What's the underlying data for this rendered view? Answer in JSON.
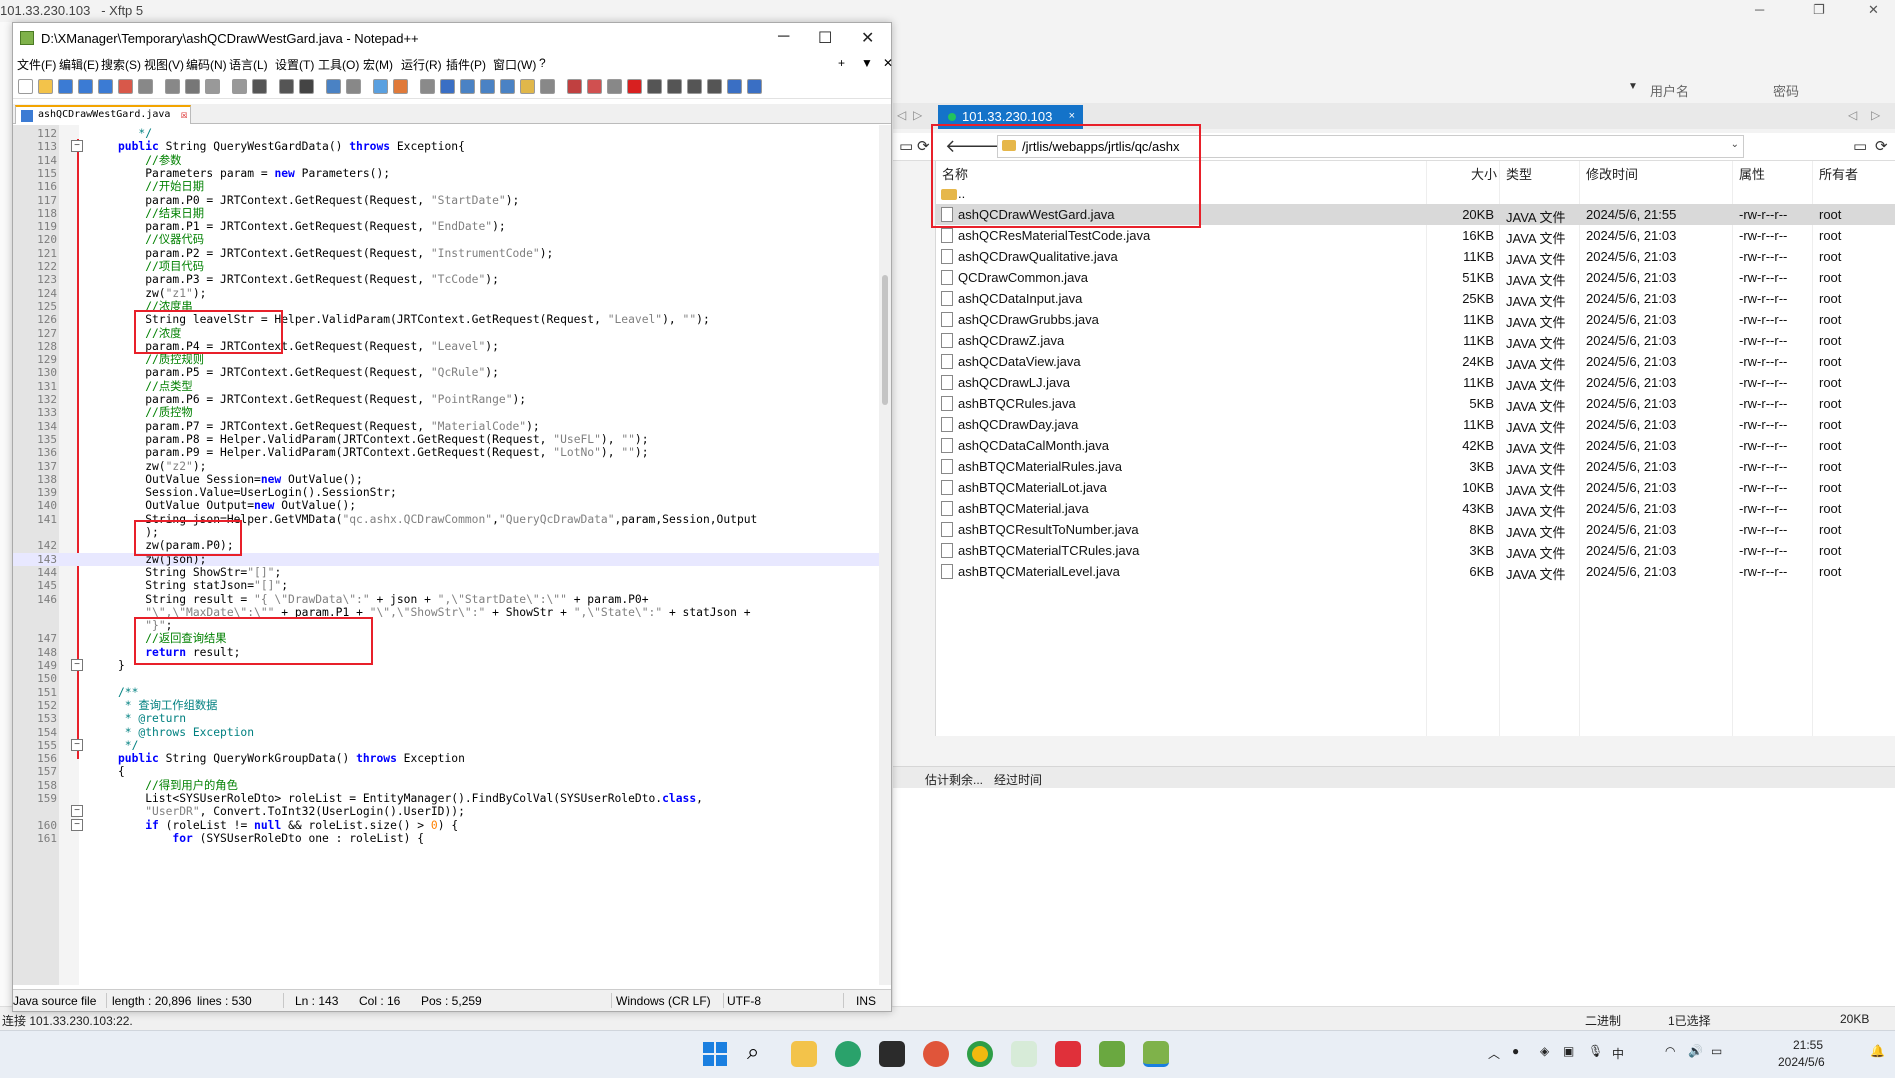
{
  "xftp": {
    "title": "101.33.230.103",
    "app": "- Xftp 5",
    "toolbar": {
      "username_label": "用户名",
      "password_label": "密码"
    },
    "tab_label": "101.33.230.103",
    "tab_close": "×",
    "address_path": "/jrtlis/webapps/jrtlis/qc/ashx",
    "columns": [
      "名称",
      "大小",
      "类型",
      "修改时间",
      "属性",
      "所有者"
    ],
    "parent_dir": "..",
    "files": [
      {
        "name": "ashQCDrawWestGard.java",
        "size": "20KB",
        "type": "JAVA 文件",
        "modified": "2024/5/6, 21:55",
        "attr": "-rw-r--r--",
        "owner": "root"
      },
      {
        "name": "ashQCResMaterialTestCode.java",
        "size": "16KB",
        "type": "JAVA 文件",
        "modified": "2024/5/6, 21:03",
        "attr": "-rw-r--r--",
        "owner": "root"
      },
      {
        "name": "ashQCDrawQualitative.java",
        "size": "11KB",
        "type": "JAVA 文件",
        "modified": "2024/5/6, 21:03",
        "attr": "-rw-r--r--",
        "owner": "root"
      },
      {
        "name": "QCDrawCommon.java",
        "size": "51KB",
        "type": "JAVA 文件",
        "modified": "2024/5/6, 21:03",
        "attr": "-rw-r--r--",
        "owner": "root"
      },
      {
        "name": "ashQCDataInput.java",
        "size": "25KB",
        "type": "JAVA 文件",
        "modified": "2024/5/6, 21:03",
        "attr": "-rw-r--r--",
        "owner": "root"
      },
      {
        "name": "ashQCDrawGrubbs.java",
        "size": "11KB",
        "type": "JAVA 文件",
        "modified": "2024/5/6, 21:03",
        "attr": "-rw-r--r--",
        "owner": "root"
      },
      {
        "name": "ashQCDrawZ.java",
        "size": "11KB",
        "type": "JAVA 文件",
        "modified": "2024/5/6, 21:03",
        "attr": "-rw-r--r--",
        "owner": "root"
      },
      {
        "name": "ashQCDataView.java",
        "size": "24KB",
        "type": "JAVA 文件",
        "modified": "2024/5/6, 21:03",
        "attr": "-rw-r--r--",
        "owner": "root"
      },
      {
        "name": "ashQCDrawLJ.java",
        "size": "11KB",
        "type": "JAVA 文件",
        "modified": "2024/5/6, 21:03",
        "attr": "-rw-r--r--",
        "owner": "root"
      },
      {
        "name": "ashBTQCRules.java",
        "size": "5KB",
        "type": "JAVA 文件",
        "modified": "2024/5/6, 21:03",
        "attr": "-rw-r--r--",
        "owner": "root"
      },
      {
        "name": "ashQCDrawDay.java",
        "size": "11KB",
        "type": "JAVA 文件",
        "modified": "2024/5/6, 21:03",
        "attr": "-rw-r--r--",
        "owner": "root"
      },
      {
        "name": "ashQCDataCalMonth.java",
        "size": "42KB",
        "type": "JAVA 文件",
        "modified": "2024/5/6, 21:03",
        "attr": "-rw-r--r--",
        "owner": "root"
      },
      {
        "name": "ashBTQCMaterialRules.java",
        "size": "3KB",
        "type": "JAVA 文件",
        "modified": "2024/5/6, 21:03",
        "attr": "-rw-r--r--",
        "owner": "root"
      },
      {
        "name": "ashBTQCMaterialLot.java",
        "size": "10KB",
        "type": "JAVA 文件",
        "modified": "2024/5/6, 21:03",
        "attr": "-rw-r--r--",
        "owner": "root"
      },
      {
        "name": "ashBTQCMaterial.java",
        "size": "43KB",
        "type": "JAVA 文件",
        "modified": "2024/5/6, 21:03",
        "attr": "-rw-r--r--",
        "owner": "root"
      },
      {
        "name": "ashBTQCResultToNumber.java",
        "size": "8KB",
        "type": "JAVA 文件",
        "modified": "2024/5/6, 21:03",
        "attr": "-rw-r--r--",
        "owner": "root"
      },
      {
        "name": "ashBTQCMaterialTCRules.java",
        "size": "3KB",
        "type": "JAVA 文件",
        "modified": "2024/5/6, 21:03",
        "attr": "-rw-r--r--",
        "owner": "root"
      },
      {
        "name": "ashBTQCMaterialLevel.java",
        "size": "6KB",
        "type": "JAVA 文件",
        "modified": "2024/5/6, 21:03",
        "attr": "-rw-r--r--",
        "owner": "root"
      }
    ],
    "transfer_columns": [
      "估计剩余...",
      "经过时间"
    ],
    "status": {
      "connection": "连接 101.33.230.103:22.",
      "mode": "二进制",
      "selection": "1已选择",
      "size": "20KB"
    }
  },
  "npp": {
    "title": "D:\\XManager\\Temporary\\ashQCDrawWestGard.java - Notepad++",
    "menu": [
      "文件(F)",
      "编辑(E)",
      "搜索(S)",
      "视图(V)",
      "编码(N)",
      "语言(L)",
      "设置(T)",
      "工具(O)",
      "宏(M)",
      "运行(R)",
      "插件(P)",
      "窗口(W)",
      "?"
    ],
    "menu_right": [
      "+",
      "▼",
      "✕"
    ],
    "tab_label": "ashQCDrawWestGard.java",
    "code_lines": [
      {
        "n": "112",
        "html": "<span class='doc'>   */</span>"
      },
      {
        "n": "113",
        "html": "<span class='kw'>public</span> String QueryWestGardData() <span class='kw'>throws</span> Exception{"
      },
      {
        "n": "114",
        "html": "    <span class='cm'>//参数</span>"
      },
      {
        "n": "115",
        "html": "    Parameters param = <span class='kw'>new</span> Parameters();"
      },
      {
        "n": "116",
        "html": "    <span class='cm'>//开始日期</span>"
      },
      {
        "n": "117",
        "html": "    param.P0 = JRTContext.GetRequest(Request, <span class='str'>\"StartDate\"</span>);"
      },
      {
        "n": "118",
        "html": "    <span class='cm'>//结束日期</span>"
      },
      {
        "n": "119",
        "html": "    param.P1 = JRTContext.GetRequest(Request, <span class='str'>\"EndDate\"</span>);"
      },
      {
        "n": "120",
        "html": "    <span class='cm'>//仪器代码</span>"
      },
      {
        "n": "121",
        "html": "    param.P2 = JRTContext.GetRequest(Request, <span class='str'>\"InstrumentCode\"</span>);"
      },
      {
        "n": "122",
        "html": "    <span class='cm'>//项目代码</span>"
      },
      {
        "n": "123",
        "html": "    param.P3 = JRTContext.GetRequest(Request, <span class='str'>\"TcCode\"</span>);"
      },
      {
        "n": "124",
        "html": "    zw(<span class='str'>\"z1\"</span>);"
      },
      {
        "n": "125",
        "html": "    <span class='cm'>//浓度串</span>"
      },
      {
        "n": "126",
        "html": "    String leavelStr = Helper.ValidParam(JRTContext.GetRequest(Request, <span class='str'>\"Leavel\"</span>), <span class='str'>\"\"</span>);"
      },
      {
        "n": "127",
        "html": "    <span class='cm'>//浓度</span>"
      },
      {
        "n": "128",
        "html": "    param.P4 = JRTContext.GetRequest(Request, <span class='str'>\"Leavel\"</span>);"
      },
      {
        "n": "129",
        "html": "    <span class='cm'>//质控规则</span>"
      },
      {
        "n": "130",
        "html": "    param.P5 = JRTContext.GetRequest(Request, <span class='str'>\"QcRule\"</span>);"
      },
      {
        "n": "131",
        "html": "    <span class='cm'>//点类型</span>"
      },
      {
        "n": "132",
        "html": "    param.P6 = JRTContext.GetRequest(Request, <span class='str'>\"PointRange\"</span>);"
      },
      {
        "n": "133",
        "html": "    <span class='cm'>//质控物</span>"
      },
      {
        "n": "134",
        "html": "    param.P7 = JRTContext.GetRequest(Request, <span class='str'>\"MaterialCode\"</span>);"
      },
      {
        "n": "135",
        "html": "    param.P8 = Helper.ValidParam(JRTContext.GetRequest(Request, <span class='str'>\"UseFL\"</span>), <span class='str'>\"\"</span>);"
      },
      {
        "n": "136",
        "html": "    param.P9 = Helper.ValidParam(JRTContext.GetRequest(Request, <span class='str'>\"LotNo\"</span>), <span class='str'>\"\"</span>);"
      },
      {
        "n": "137",
        "html": "    zw(<span class='str'>\"z2\"</span>);"
      },
      {
        "n": "138",
        "html": "    OutValue Session=<span class='kw'>new</span> OutValue();"
      },
      {
        "n": "139",
        "html": "    Session.Value=UserLogin().SessionStr;"
      },
      {
        "n": "140",
        "html": "    OutValue Output=<span class='kw'>new</span> OutValue();"
      },
      {
        "n": "141",
        "html": "    String json=Helper.GetVMData(<span class='str'>\"qc.ashx.QCDrawCommon\"</span>,<span class='str'>\"QueryQcDrawData\"</span>,param,Session,Output"
      },
      {
        "n": "",
        "html": "    );"
      },
      {
        "n": "142",
        "html": "    zw(param.P0);"
      },
      {
        "n": "143",
        "html": "    zw(json);",
        "current": true
      },
      {
        "n": "144",
        "html": "    String ShowStr=<span class='str'>\"[]\"</span>;"
      },
      {
        "n": "145",
        "html": "    String statJson=<span class='str'>\"[]\"</span>;"
      },
      {
        "n": "146",
        "html": "    String result = <span class='str'>\"{ \\\"DrawData\\\":\"</span> + json + <span class='str'>\",\\\"StartDate\\\":\\\"\"</span> + param.P0+"
      },
      {
        "n": "",
        "html": "    <span class='str'>\"\\\",\\\"MaxDate\\\":\\\"\"</span> + param.P1 + <span class='str'>\"\\\",\\\"ShowStr\\\":\"</span> + ShowStr + <span class='str'>\",\\\"State\\\":\"</span> + statJson +"
      },
      {
        "n": "",
        "html": "    <span class='str'>\"}\"</span>;"
      },
      {
        "n": "147",
        "html": "    <span class='cm'>//返回查询结果</span>"
      },
      {
        "n": "148",
        "html": "    <span class='kw'>return</span> result;"
      },
      {
        "n": "149",
        "html": "}"
      },
      {
        "n": "150",
        "html": ""
      },
      {
        "n": "151",
        "html": "<span class='doc'>/**</span>"
      },
      {
        "n": "152",
        "html": "<span class='doc'> * 查询工作组数据</span>"
      },
      {
        "n": "153",
        "html": "<span class='doc'> * @return</span>"
      },
      {
        "n": "154",
        "html": "<span class='doc'> * @throws Exception</span>"
      },
      {
        "n": "155",
        "html": "<span class='doc'> */</span>"
      },
      {
        "n": "156",
        "html": "<span class='kw'>public</span> String QueryWorkGroupData() <span class='kw'>throws</span> Exception"
      },
      {
        "n": "157",
        "html": "{"
      },
      {
        "n": "158",
        "html": "    <span class='cm'>//得到用户的角色</span>"
      },
      {
        "n": "159",
        "html": "    List&lt;SYSUserRoleDto&gt; roleList = EntityManager().FindByColVal(SYSUserRoleDto.<span class='kw'>class</span>,"
      },
      {
        "n": "",
        "html": "    <span class='str'>\"UserDR\"</span>, Convert.ToInt32(UserLogin().UserID));"
      },
      {
        "n": "160",
        "html": "    <span class='kw'>if</span> (roleList != <span class='kw'>null</span> &amp;&amp; roleList.size() &gt; <span class='num'>0</span>) {"
      },
      {
        "n": "161",
        "html": "        <span class='kw'>for</span> (SYSUserRoleDto one : roleList) {"
      }
    ],
    "status": {
      "lang": "Java source file",
      "length": "length : 20,896",
      "lines": "lines : 530",
      "ln": "Ln : 143",
      "col": "Col : 16",
      "pos": "Pos : 5,259",
      "eol": "Windows (CR LF)",
      "enc": "UTF-8",
      "ins": "INS"
    }
  },
  "taskbar": {
    "time": "21:55",
    "date": "2024/5/6",
    "ime": "中"
  }
}
